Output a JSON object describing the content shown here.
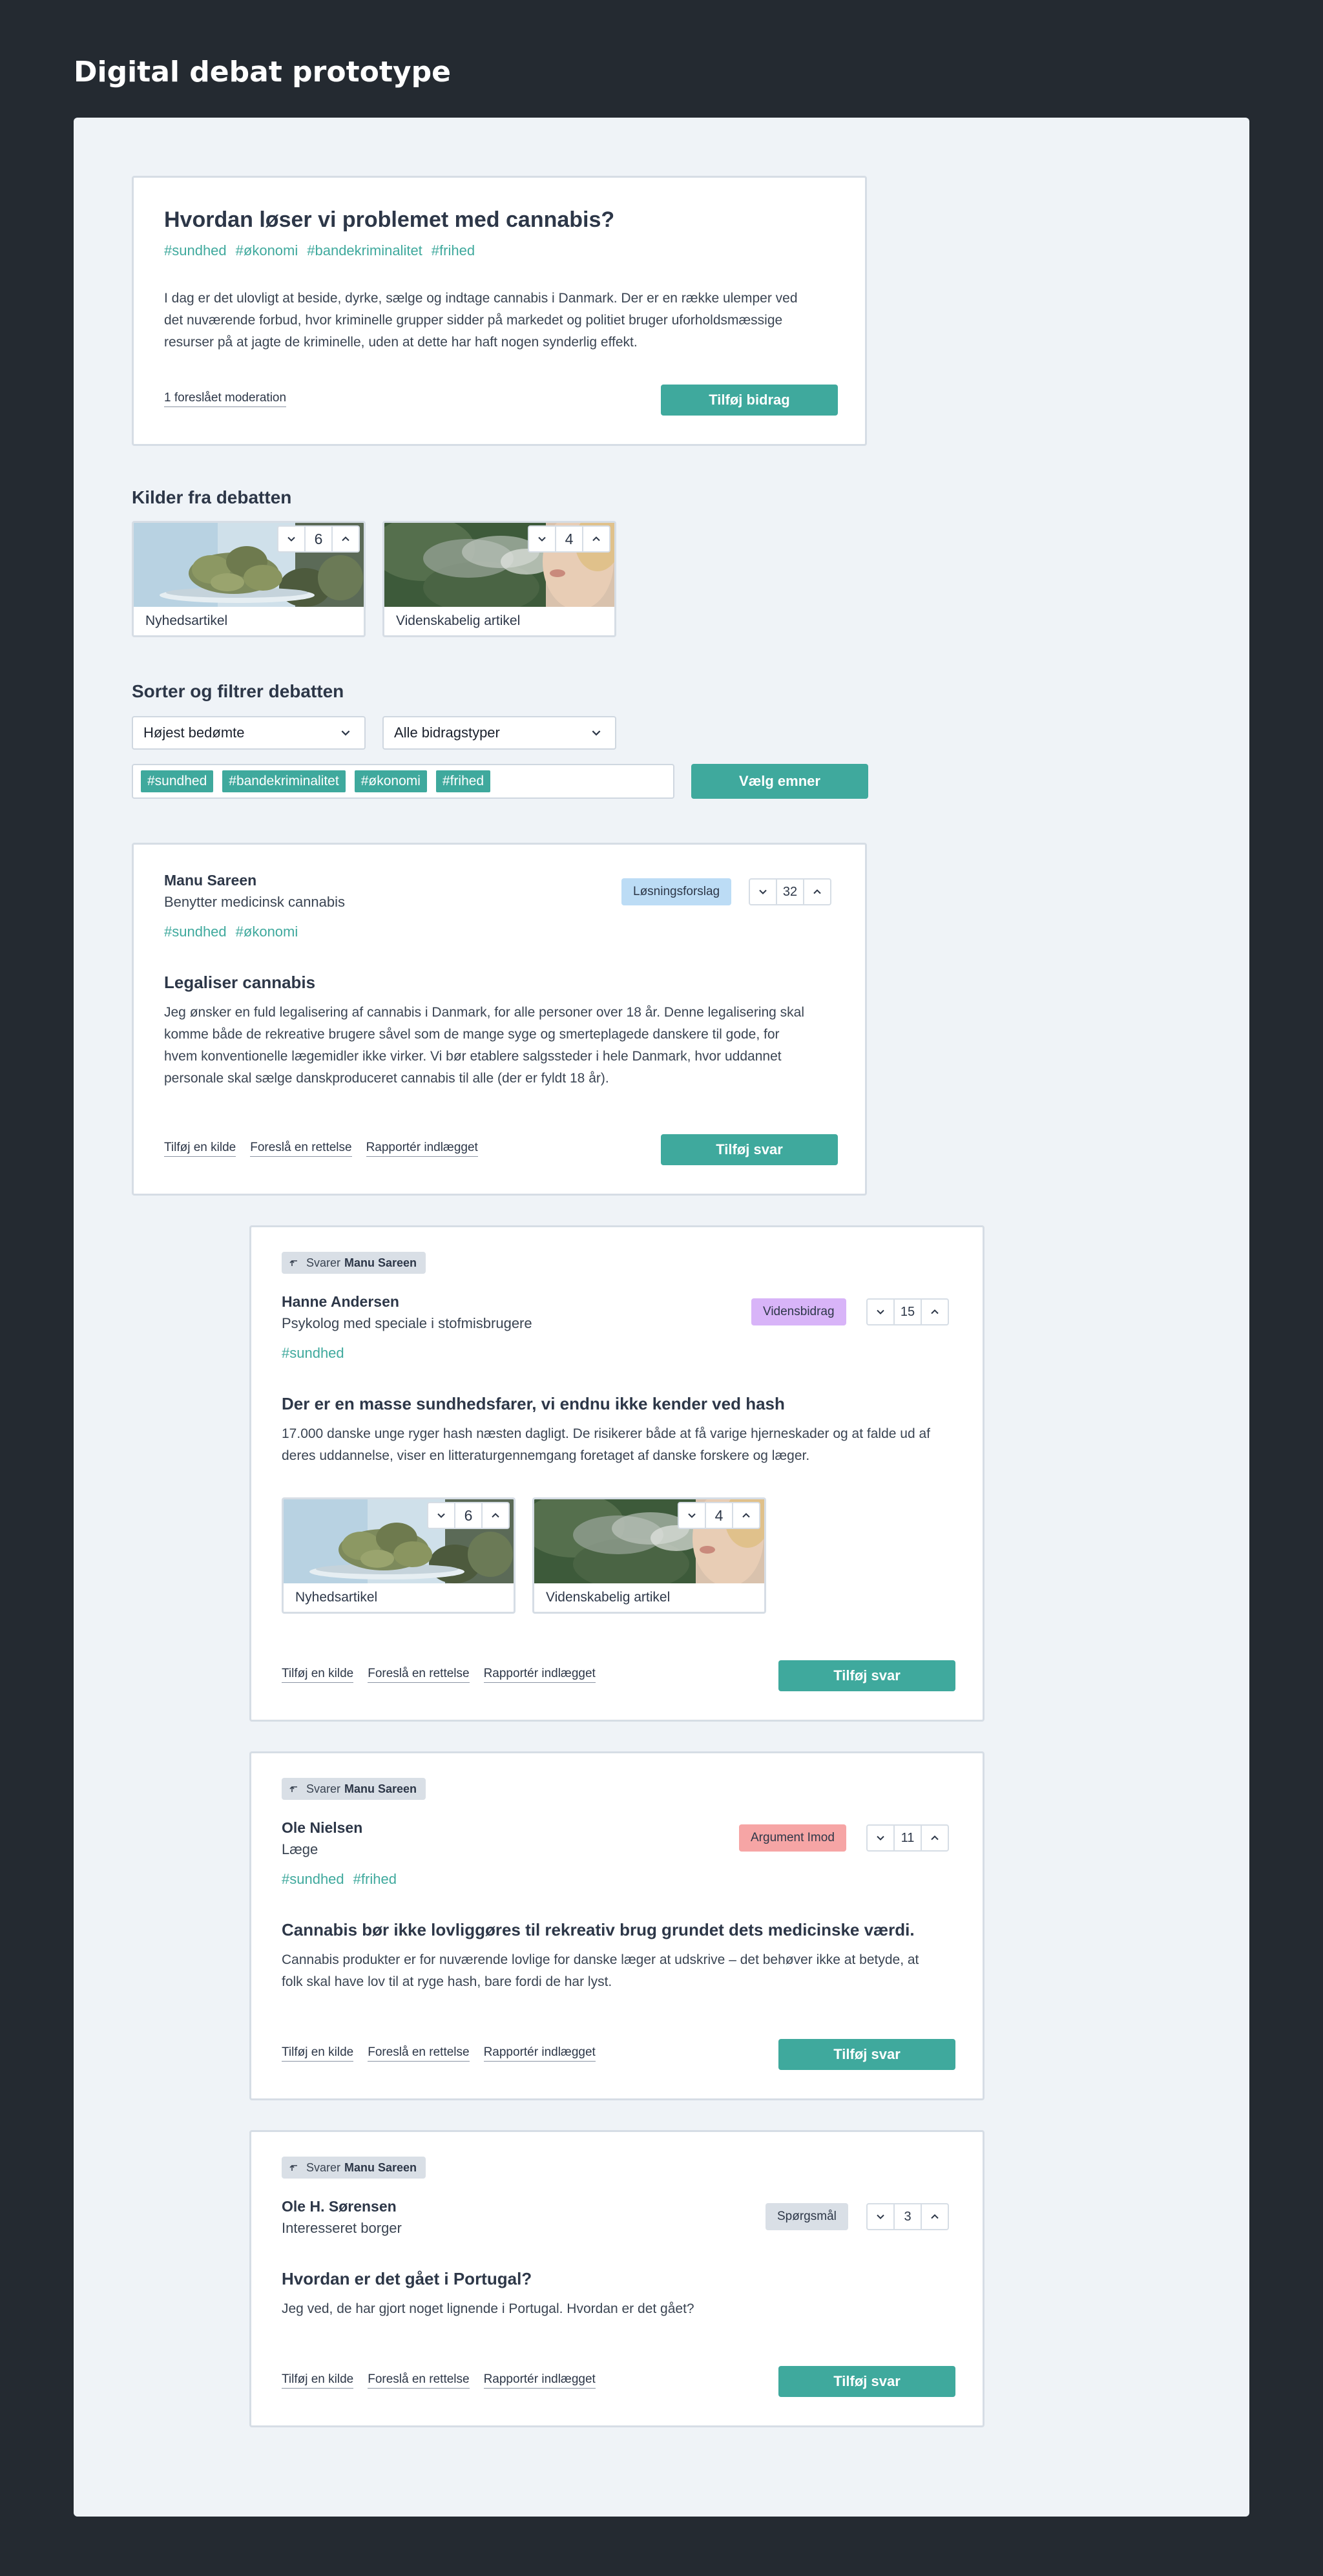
{
  "page": {
    "title": "Digital debat prototype"
  },
  "question": {
    "title": "Hvordan løser vi problemet med cannabis?",
    "tags": [
      "#sundhed",
      "#økonomi",
      "#bandekriminalitet",
      "#frihed"
    ],
    "body": [
      "I dag er det ulovligt at beside, dyrke, sælge og indtage cannabis i Danmark. Der er en række ulemper ved",
      "det nuværende forbud, hvor kriminelle grupper sidder på markedet og politiet bruger uforholdsmæssige",
      "resurser på at jagte de kriminelle, uden at dette har haft nogen synderlig effekt."
    ],
    "moderation_link": "1 foreslået moderation",
    "add_button": "Tilføj bidrag"
  },
  "sources_section": {
    "title": "Kilder fra debatten",
    "items": [
      {
        "label": "Nyhedsartikel",
        "votes": "6",
        "image_icon": "cannabis-photo"
      },
      {
        "label": "Videnskabelig artikel",
        "votes": "4",
        "image_icon": "smoke-photo"
      }
    ]
  },
  "filters": {
    "title": "Sorter og filtrer debatten",
    "sort_value": "Højest bedømte",
    "type_value": "Alle bidragstyper",
    "topics": [
      "#sundhed",
      "#bandekriminalitet",
      "#økonomi",
      "#frihed"
    ],
    "topics_button": "Vælg emner"
  },
  "posts": [
    {
      "author": "Manu Sareen",
      "role": "Benytter medicinsk cannabis",
      "tags": [
        "#sundhed",
        "#økonomi"
      ],
      "badge": "Løsningsforslag",
      "votes": "32",
      "title": "Legaliser cannabis",
      "body": [
        "Jeg ønsker en fuld legalisering af cannabis i Danmark, for alle personer over 18 år. Denne legalisering skal",
        "komme både de rekreative brugere såvel som de mange syge og smerteplagede danskere til gode, for",
        "hvem konventionelle lægemidler ikke virker. Vi bør etablere salgssteder i hele Danmark, hvor uddannet",
        "personale skal sælge danskproduceret cannabis til alle (der er fyldt 18 år)."
      ],
      "actions": [
        "Tilføj en kilde",
        "Foreslå en rettelse",
        "Rapportér indlægget"
      ],
      "reply_button": "Tilføj svar"
    },
    {
      "reply_prefix": "Svarer",
      "reply_to": "Manu Sareen",
      "author": "Hanne Andersen",
      "role": "Psykolog med speciale i stofmisbrugere",
      "tags": [
        "#sundhed"
      ],
      "badge": "Vidensbidrag",
      "votes": "15",
      "title": "Der er en masse sundhedsfarer, vi endnu ikke kender ved hash",
      "body": [
        "17.000 danske unge ryger hash næsten dagligt. De risikerer både at få varige hjerneskader og at falde ud af",
        "deres uddannelse, viser en litteraturgennemgang foretaget af danske forskere og læger."
      ],
      "sources": [
        {
          "label": "Nyhedsartikel",
          "votes": "6"
        },
        {
          "label": "Videnskabelig artikel",
          "votes": "4"
        }
      ],
      "actions": [
        "Tilføj en kilde",
        "Foreslå en rettelse",
        "Rapportér indlægget"
      ],
      "reply_button": "Tilføj svar"
    },
    {
      "reply_prefix": "Svarer",
      "reply_to": "Manu Sareen",
      "author": "Ole Nielsen",
      "role": "Læge",
      "tags": [
        "#sundhed",
        "#frihed"
      ],
      "badge": "Argument Imod",
      "votes": "11",
      "title": "Cannabis bør ikke lovliggøres til rekreativ brug grundet dets medicinske værdi.",
      "body": [
        "Cannabis produkter er for nuværende lovlige for danske læger at udskrive – det behøver ikke at betyde, at",
        "folk skal have lov til at ryge hash, bare fordi de har lyst."
      ],
      "actions": [
        "Tilføj en kilde",
        "Foreslå en rettelse",
        "Rapportér indlægget"
      ],
      "reply_button": "Tilføj svar"
    },
    {
      "reply_prefix": "Svarer",
      "reply_to": "Manu Sareen",
      "author": "Ole H. Sørensen",
      "role": "Interesseret borger",
      "badge": "Spørgsmål",
      "votes": "3",
      "title": "Hvordan er det gået i Portugal?",
      "body": [
        "Jeg ved, de har gjort noget lignende i Portugal. Hvordan er det gået?"
      ],
      "actions": [
        "Tilføj en kilde",
        "Foreslå en rettelse",
        "Rapportér indlægget"
      ],
      "reply_button": "Tilføj svar"
    }
  ],
  "colors": {
    "background": "#242a31",
    "panel": "#eff3f7",
    "accent": "#3fa99d",
    "badge_solution": "#bcdcf5",
    "badge_knowledge": "#d8b4f8",
    "badge_against": "#f6a5a5",
    "badge_question": "#d9dfe6"
  }
}
